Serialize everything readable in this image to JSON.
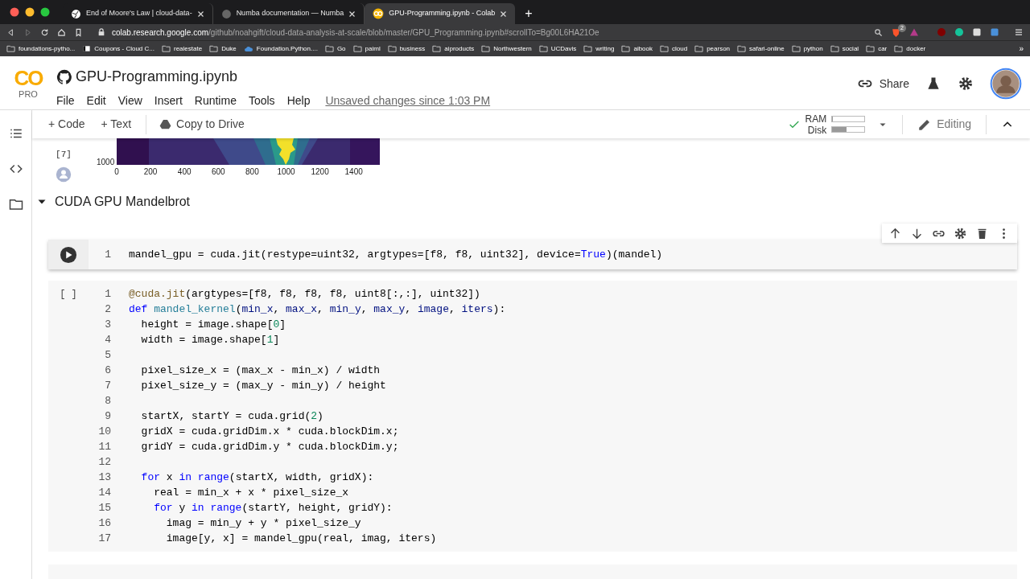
{
  "browser": {
    "tabs": [
      {
        "title": "End of Moore's Law | cloud-data-",
        "selected": false,
        "kind": "globe"
      },
      {
        "title": "Numba documentation — Numba",
        "selected": false,
        "kind": "dim"
      },
      {
        "title": "GPU-Programming.ipynb - Colab",
        "selected": true,
        "kind": "colab"
      }
    ],
    "new_tab": "+",
    "url_host": "colab.research.google.com",
    "url_path": "/github/noahgift/cloud-data-analysis-at-scale/blob/master/GPU_Programming.ipynb#scrollTo=Bg00L6HA21Oe",
    "extension_badge": "2",
    "bookmarks": [
      {
        "label": "foundations-pytho...",
        "kind": "folder"
      },
      {
        "label": "Coupons - Cloud C...",
        "kind": "page"
      },
      {
        "label": "realestate",
        "kind": "folder"
      },
      {
        "label": "Duke",
        "kind": "folder"
      },
      {
        "label": "Foundation.Python....",
        "kind": "cloud"
      },
      {
        "label": "Go",
        "kind": "folder"
      },
      {
        "label": "paiml",
        "kind": "folder"
      },
      {
        "label": "business",
        "kind": "folder"
      },
      {
        "label": "aiproducts",
        "kind": "folder"
      },
      {
        "label": "Northwestern",
        "kind": "folder"
      },
      {
        "label": "UCDavis",
        "kind": "folder"
      },
      {
        "label": "writing",
        "kind": "folder"
      },
      {
        "label": "aibook",
        "kind": "folder"
      },
      {
        "label": "cloud",
        "kind": "folder"
      },
      {
        "label": "pearson",
        "kind": "folder"
      },
      {
        "label": "safari-online",
        "kind": "folder"
      },
      {
        "label": "python",
        "kind": "folder"
      },
      {
        "label": "social",
        "kind": "folder"
      },
      {
        "label": "car",
        "kind": "folder"
      },
      {
        "label": "docker",
        "kind": "folder"
      }
    ],
    "bookmarks_more": "»"
  },
  "colab": {
    "logo": "CO",
    "plan": "PRO",
    "title": "GPU-Programming.ipynb",
    "menu": [
      "File",
      "Edit",
      "View",
      "Insert",
      "Runtime",
      "Tools",
      "Help"
    ],
    "unsaved_note": "Unsaved changes since 1:03 PM",
    "share": "Share",
    "toolbar": {
      "add_code": "+ Code",
      "add_text": "+ Text",
      "copy_to_drive": "Copy to Drive",
      "resources": [
        {
          "label": "RAM",
          "level": 0.03
        },
        {
          "label": "Disk",
          "level": 0.45
        }
      ],
      "mode": "Editing"
    }
  },
  "output_cell": {
    "execution_count": "[7]",
    "y_tick": "1000",
    "x_ticks": [
      "0",
      "200",
      "400",
      "600",
      "800",
      "1000",
      "1200",
      "1400"
    ]
  },
  "section": {
    "title": "CUDA GPU Mandelbrot",
    "expanded": true
  },
  "cells": [
    {
      "focused": true,
      "lines": [
        {
          "number": "1",
          "segments": [
            {
              "kind": "plain",
              "text": "mandel_gpu = cuda.jit(restype=uint32, argtypes=[f8, f8, uint32], device="
            },
            {
              "kind": "keyword",
              "text": "True"
            },
            {
              "kind": "plain",
              "text": ")(mandel)"
            }
          ]
        }
      ]
    },
    {
      "prompt": "[ ]",
      "focused": false,
      "lines": [
        {
          "number": "1",
          "segments": [
            {
              "kind": "decorator",
              "text": "@cuda.jit"
            },
            {
              "kind": "plain",
              "text": "(argtypes=[f8, f8, f8, f8, uint8[:,:], uint32])"
            }
          ]
        },
        {
          "number": "2",
          "segments": [
            {
              "kind": "keyword",
              "text": "def"
            },
            {
              "kind": "function",
              "text": " mandel_kernel"
            },
            {
              "kind": "plain",
              "text": "("
            },
            {
              "kind": "param",
              "text": "min_x"
            },
            {
              "kind": "plain",
              "text": ", "
            },
            {
              "kind": "param",
              "text": "max_x"
            },
            {
              "kind": "plain",
              "text": ", "
            },
            {
              "kind": "param",
              "text": "min_y"
            },
            {
              "kind": "plain",
              "text": ", "
            },
            {
              "kind": "param",
              "text": "max_y"
            },
            {
              "kind": "plain",
              "text": ", "
            },
            {
              "kind": "param",
              "text": "image"
            },
            {
              "kind": "plain",
              "text": ", "
            },
            {
              "kind": "param",
              "text": "iters"
            },
            {
              "kind": "plain",
              "text": "):"
            }
          ]
        },
        {
          "number": "3",
          "segments": [
            {
              "kind": "plain",
              "text": "  height = image.shape["
            },
            {
              "kind": "number",
              "text": "0"
            },
            {
              "kind": "plain",
              "text": "]"
            }
          ]
        },
        {
          "number": "4",
          "segments": [
            {
              "kind": "plain",
              "text": "  width = image.shape["
            },
            {
              "kind": "number",
              "text": "1"
            },
            {
              "kind": "plain",
              "text": "]"
            }
          ]
        },
        {
          "number": "5"
        },
        {
          "number": "6",
          "segments": [
            {
              "kind": "plain",
              "text": "  pixel_size_x = (max_x - min_x) / width"
            }
          ]
        },
        {
          "number": "7",
          "segments": [
            {
              "kind": "plain",
              "text": "  pixel_size_y = (max_y - min_y) / height"
            }
          ]
        },
        {
          "number": "8"
        },
        {
          "number": "9",
          "segments": [
            {
              "kind": "plain",
              "text": "  startX, startY = cuda.grid("
            },
            {
              "kind": "number",
              "text": "2"
            },
            {
              "kind": "plain",
              "text": ")"
            }
          ]
        },
        {
          "number": "10",
          "segments": [
            {
              "kind": "plain",
              "text": "  gridX = cuda.gridDim.x * cuda.blockDim.x;"
            }
          ]
        },
        {
          "number": "11",
          "segments": [
            {
              "kind": "plain",
              "text": "  gridY = cuda.gridDim.y * cuda.blockDim.y;"
            }
          ]
        },
        {
          "number": "12"
        },
        {
          "number": "13",
          "segments": [
            {
              "kind": "keyword",
              "text": "  for"
            },
            {
              "kind": "plain",
              "text": " x "
            },
            {
              "kind": "keyword",
              "text": "in range"
            },
            {
              "kind": "plain",
              "text": "(startX, width, gridX):"
            }
          ]
        },
        {
          "number": "14",
          "segments": [
            {
              "kind": "plain",
              "text": "    real = min_x + x * pixel_size_x"
            }
          ]
        },
        {
          "number": "15",
          "segments": [
            {
              "kind": "keyword",
              "text": "    for"
            },
            {
              "kind": "plain",
              "text": " y "
            },
            {
              "kind": "keyword",
              "text": "in range"
            },
            {
              "kind": "plain",
              "text": "(startY, height, gridY):"
            }
          ]
        },
        {
          "number": "16",
          "segments": [
            {
              "kind": "plain",
              "text": "      imag = min_y + y * pixel_size_y"
            }
          ]
        },
        {
          "number": "17",
          "segments": [
            {
              "kind": "plain",
              "text": "      image[y, x] = mandel_gpu(real, imag, iters)"
            }
          ]
        }
      ]
    }
  ]
}
